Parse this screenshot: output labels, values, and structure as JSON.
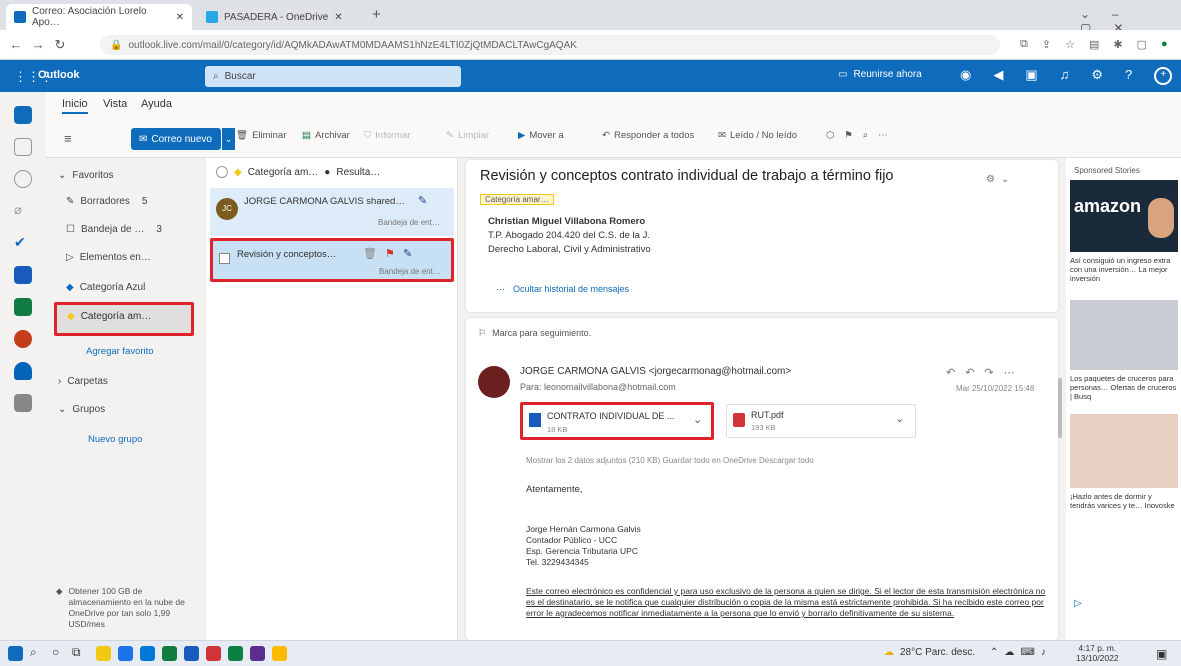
{
  "browser": {
    "tab1": "Correo: Asociación Lorelo Apo…",
    "tab2": "PASADERA - OneDrive",
    "url": "outlook.live.com/mail/0/category/id/AQMkADAwATM0MDAAMS1hNzE4LTI0ZjQtMDACLTAwCgAQAK",
    "new_tab": "+"
  },
  "outlook": {
    "app_name": "Outlook",
    "search_placeholder": "Buscar",
    "meet_now": "Reunirse ahora"
  },
  "ribbon": {
    "tabs": [
      "Inicio",
      "Vista",
      "Ayuda"
    ],
    "new_mail": "Correo nuevo",
    "actions": [
      "Eliminar",
      "Archivar",
      "Informar",
      "Limpiar",
      "Mover a",
      "Responder a todos",
      "Leído / No leído"
    ]
  },
  "folders": {
    "favorites": "Favoritos",
    "items": [
      {
        "label": "Borradores",
        "count": "5"
      },
      {
        "label": "Bandeja de …",
        "count": "3"
      },
      {
        "label": "Elementos en…",
        "count": ""
      },
      {
        "label": "Categoría Azul",
        "count": ""
      },
      {
        "label": "Categoría am…",
        "count": ""
      }
    ],
    "add_favorite": "Agregar favorito",
    "folders_section": "Carpetas",
    "groups_section": "Grupos",
    "new_group": "Nuevo grupo",
    "storage_note": "Obtener 100 GB de almacenamiento en la nube de OneDrive por tan solo 1,99 USD/mes"
  },
  "message_list": {
    "header_category": "Categoría am…",
    "header_results": "Resulta…",
    "messages": [
      {
        "sender": "JORGE CARMONA GALVIS shared…",
        "folder": "Bandeja de ent…"
      },
      {
        "sender": "Revisión y conceptos…",
        "folder": "Bandeja de ent…"
      }
    ]
  },
  "reading": {
    "subject": "Revisión y conceptos contrato individual de trabajo a término fijo",
    "category_tag": "Categoría amar…",
    "signature": [
      "Christian Miguel Villabona Romero",
      "T.P. Abogado 204.420 del C.S. de la J.",
      "Derecho Laboral, Civil y Administrativo"
    ],
    "show_history": "Ocultar historial de mensajes",
    "flag_followup": "Marca para seguimiento.",
    "sender": "JORGE CARMONA GALVIS <jorgecarmonag@hotmail.com>",
    "to": "Para: leonomailvillabona@hotmail.com",
    "date": "Mar 25/10/2022 15:48",
    "attachment1": "CONTRATO INDIVIDUAL DE ...",
    "attachment1_size": "18 KB",
    "attachment2": "RUT.pdf",
    "attachment2_size": "193 KB",
    "attach_actions": "Mostrar los 2 datos adjuntos (210 KB)   Guardar todo en OneDrive   Descargar todo",
    "greeting": "Atentamente,",
    "sig2": [
      "Jorge Hernán Carmona Galvis",
      "Contador Público - UCC",
      "Esp. Gerencia Tributaria UPC",
      "Tel. 3229434345"
    ],
    "disclaimer": "Este correo electrónico es confidencial y para uso exclusivo de la persona a quien se dirige. Si el lector de esta transmisión electrónica no es el destinatario, se le notifica que cualquier distribución o copia de la misma está estrictamente prohibida. Si ha recibido este correo por error le agradecemos notificar inmediatamente a la persona que lo envió y borrarlo definitivamente de su sistema."
  },
  "ads": {
    "sponsored": "Sponsored Stories",
    "brand": "amazon",
    "ad1": "Así consiguió un ingreso extra con una inversión… La mejor inversión",
    "ad2": "Los paquetes de cruceros para personas… Ofertas de cruceros | Busq",
    "ad3": "¡Hazlo antes de dormir y tendrás varices y te… Inovoske"
  },
  "taskbar": {
    "weather": "28°C Parc. desc.",
    "time": "4:17 p. m.",
    "date": "13/10/2022"
  }
}
